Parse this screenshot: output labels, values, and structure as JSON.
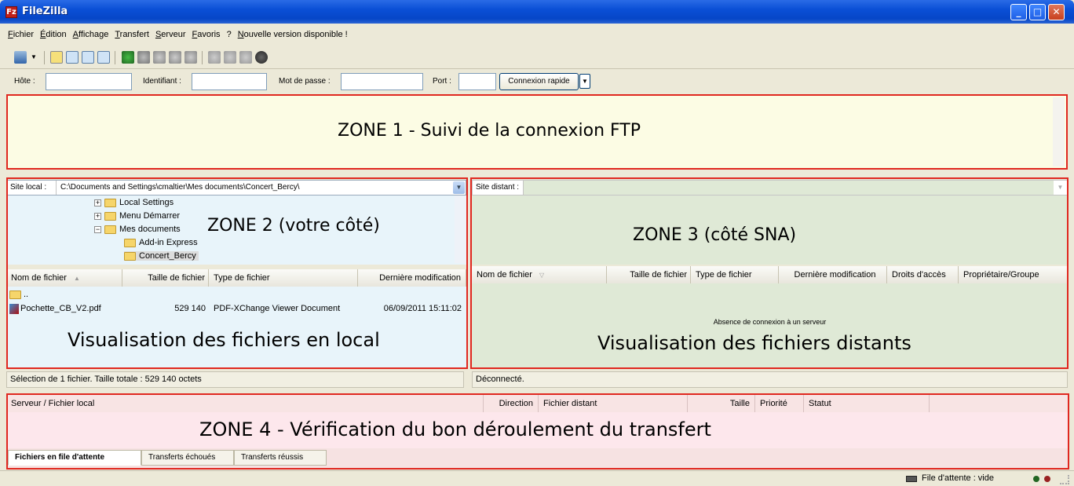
{
  "window": {
    "title": "FileZilla",
    "minimize": "_",
    "maximize": "□",
    "close": "✕"
  },
  "menu": [
    "Fichier",
    "Édition",
    "Affichage",
    "Transfert",
    "Serveur",
    "Favoris",
    "?",
    "Nouvelle version disponible !"
  ],
  "toolbar_icons": [
    "site-manager-icon",
    "dropdown-icon",
    "message-log-icon",
    "local-tree-icon",
    "remote-tree-icon",
    "queue-icon",
    "refresh-icon",
    "process-queue-icon",
    "cancel-icon",
    "disconnect-icon",
    "reconnect-icon",
    "directory-compare-icon",
    "filter-icon",
    "sync-browse-icon",
    "search-icon"
  ],
  "quickconnect": {
    "host_label": "Hôte :",
    "user_label": "Identifiant :",
    "pass_label": "Mot de passe :",
    "port_label": "Port :",
    "button_label": "Connexion rapide",
    "arrow": "▼"
  },
  "zone1": {
    "label": "ZONE 1  -  Suivi de la connexion FTP"
  },
  "local": {
    "site_label": "Site local :",
    "path": "C:\\Documents and Settings\\cmaltier\\Mes documents\\Concert_Bercy\\",
    "tree": [
      {
        "label": "Local Settings",
        "expander": "+"
      },
      {
        "label": "Menu Démarrer",
        "expander": "+"
      },
      {
        "label": "Mes documents",
        "expander": "−"
      },
      {
        "label": "Add-in Express",
        "expander": ""
      },
      {
        "label": "Concert_Bercy",
        "expander": ""
      }
    ],
    "zone_label": "ZONE 2  (votre côté)",
    "columns": [
      "Nom de fichier",
      "Taille de fichier",
      "Type de fichier",
      "Dernière modification"
    ],
    "sort_glyph": "▲",
    "parent_dir": "..",
    "files": [
      {
        "name": "Pochette_CB_V2.pdf",
        "size": "529 140",
        "type": "PDF-XChange Viewer Document",
        "modified": "06/09/2011 15:11:02"
      }
    ],
    "list_label": "Visualisation des fichiers en local",
    "status": "Sélection de 1 fichier. Taille totale : 529 140 octets"
  },
  "remote": {
    "site_label": "Site distant :",
    "path": "",
    "zone_label": "ZONE 3 (côté SNA)",
    "columns": [
      "Nom de fichier",
      "Taille de fichier",
      "Type de fichier",
      "Dernière modification",
      "Droits d'accès",
      "Propriétaire/Groupe"
    ],
    "sort_glyph": "▽",
    "empty_message": "Absence de connexion à un serveur",
    "list_label": "Visualisation des fichiers distants",
    "status": "Déconnecté."
  },
  "queue": {
    "columns": [
      "Serveur / Fichier local",
      "Direction",
      "Fichier distant",
      "Taille",
      "Priorité",
      "Statut"
    ],
    "zone_label": "ZONE 4  -  Vérification du bon déroulement du transfert",
    "tabs": [
      "Fichiers en file d'attente",
      "Transferts échoués",
      "Transferts réussis"
    ]
  },
  "statusbar": {
    "queue_text": "File d'attente : vide"
  },
  "colors": {
    "zone_border": "#e0271f",
    "zone1_bg": "#fcfce4",
    "local_bg": "#e8f4fa",
    "remote_bg": "#dfe9d6",
    "queue_bg": "#fde7ec"
  }
}
